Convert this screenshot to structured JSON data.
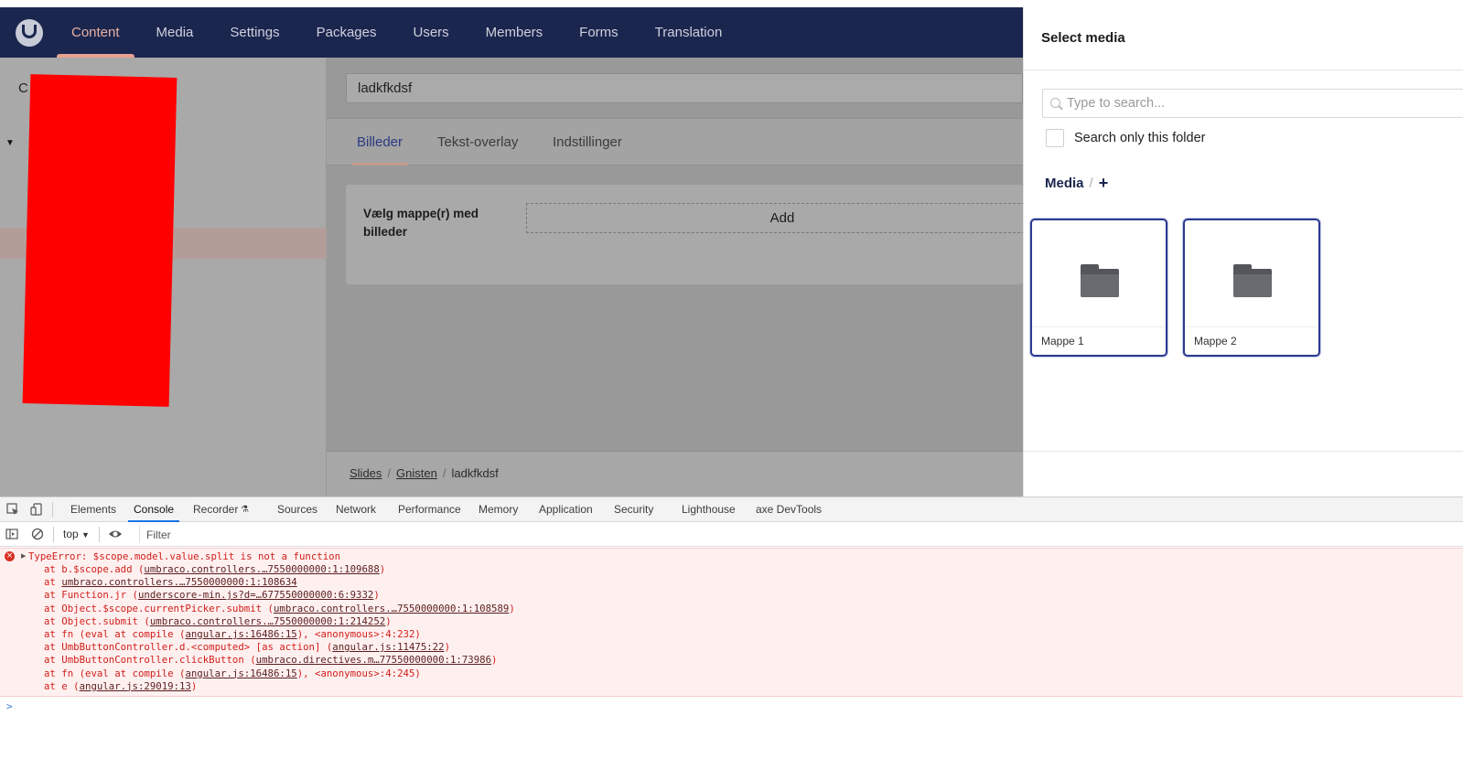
{
  "header": {
    "nav": [
      "Content",
      "Media",
      "Settings",
      "Packages",
      "Users",
      "Members",
      "Forms",
      "Translation"
    ],
    "active_nav": "Content"
  },
  "tree": {
    "partial_label": "C"
  },
  "editor": {
    "node_name": "ladkfkdsf",
    "tabs": [
      "Billeder",
      "Tekst-overlay",
      "Indstillinger"
    ],
    "active_tab": "Billeder",
    "property_label": "Vælg mappe(r) med billeder",
    "add_label": "Add",
    "breadcrumb": [
      "Slides",
      "Gnisten",
      "ladkfkdsf"
    ]
  },
  "drawer": {
    "title": "Select media",
    "search_placeholder": "Type to search...",
    "search_only_folder_label": "Search only this folder",
    "media_root": "Media",
    "media_sep": "/",
    "add_folder": "+",
    "folders": [
      "Mappe 1",
      "Mappe 2"
    ]
  },
  "devtools": {
    "tabs": [
      "Elements",
      "Console",
      "Recorder",
      "Sources",
      "Network",
      "Performance",
      "Memory",
      "Application",
      "Security",
      "Lighthouse",
      "axe DevTools"
    ],
    "active_tab": "Console",
    "context": "top",
    "filter_placeholder": "Filter",
    "error_title": "TypeError: $scope.model.value.split is not a function",
    "stack": [
      {
        "pre": "at b.$scope.add (",
        "link": "umbraco.controllers.…7550000000:1:109688",
        "post": ")"
      },
      {
        "pre": "at ",
        "link": "umbraco.controllers.…7550000000:1:108634",
        "post": ""
      },
      {
        "pre": "at Function.jr (",
        "link": "underscore-min.js?d=…677550000000:6:9332",
        "post": ")"
      },
      {
        "pre": "at Object.$scope.currentPicker.submit (",
        "link": "umbraco.controllers.…7550000000:1:108589",
        "post": ")"
      },
      {
        "pre": "at Object.submit (",
        "link": "umbraco.controllers.…7550000000:1:214252",
        "post": ")"
      },
      {
        "pre": "at fn (eval at compile (",
        "link": "angular.js:16486:15",
        "post": "), <anonymous>:4:232)"
      },
      {
        "pre": "at UmbButtonController.d.<computed> [as action] (",
        "link": "angular.js:11475:22",
        "post": ")"
      },
      {
        "pre": "at UmbButtonController.clickButton (",
        "link": "umbraco.directives.m…77550000000:1:73986",
        "post": ")"
      },
      {
        "pre": "at fn (eval at compile (",
        "link": "angular.js:16486:15",
        "post": "), <anonymous>:4:245)"
      },
      {
        "pre": "at e (",
        "link": "angular.js:29019:13",
        "post": ")"
      }
    ],
    "prompt": ">"
  },
  "colors": {
    "header_bg": "#1b264f",
    "accent": "#e8a090",
    "error_text": "#d0201a",
    "error_bg": "#fff0f0",
    "tile_border": "#2b3a8f"
  }
}
